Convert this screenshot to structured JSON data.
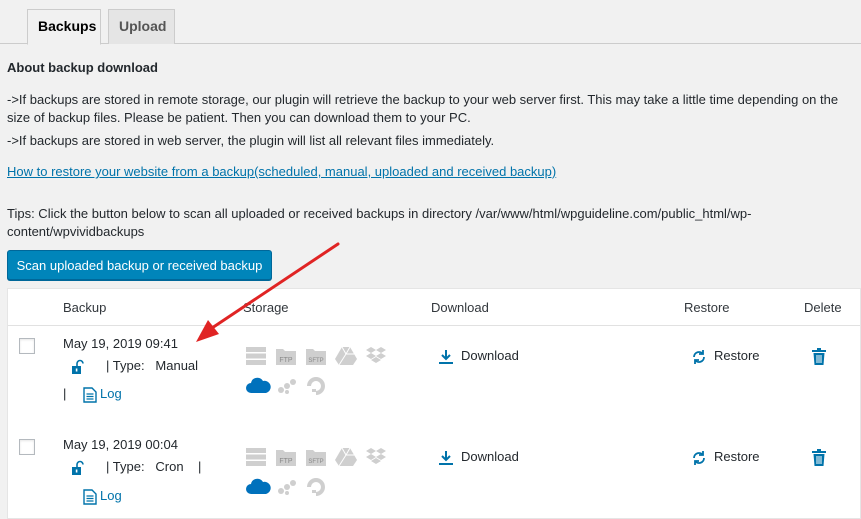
{
  "tabs": [
    {
      "label": "Backups",
      "active": true
    },
    {
      "label": "Upload",
      "active": false
    }
  ],
  "about": {
    "heading": "About backup download",
    "p1": "->If backups are stored in remote storage, our plugin will retrieve the backup to your web server first. This may take a little time depending on the size of backup files. Please be patient. Then you can download them to your PC.",
    "p2": "->If backups are stored in web server, the plugin will list all relevant files immediately.",
    "link": "How to restore your website from a backup(scheduled, manual, uploaded and received backup)",
    "tips": "Tips: Click the button below to scan all uploaded or received backups in directory /var/www/html/wpguideline.com/public_html/wp-content/wpvividbackups",
    "scan_button": "Scan uploaded backup or received backup"
  },
  "table": {
    "headers": {
      "backup": "Backup",
      "storage": "Storage",
      "download": "Download",
      "restore": "Restore",
      "delete": "Delete"
    },
    "rows": [
      {
        "date": "May 19, 2019 09:41",
        "type_label": "| Type:",
        "type_value": "Manual",
        "trail_pipe": "",
        "lead_pipe": "|",
        "log": "Log",
        "download": "Download",
        "restore": "Restore"
      },
      {
        "date": "May 19, 2019 00:04",
        "type_label": "| Type:",
        "type_value": "Cron",
        "trail_pipe": "|",
        "lead_pipe": "",
        "log": "Log",
        "download": "Download",
        "restore": "Restore"
      }
    ]
  },
  "storage_labels": {
    "ftp": "FTP",
    "sftp": "SFTP"
  },
  "colors": {
    "accent": "#0085ba",
    "link": "#0073aa",
    "onedrive": "#0071bc",
    "arrow": "#e02424",
    "inactive_icon": "#cfcfcf"
  }
}
